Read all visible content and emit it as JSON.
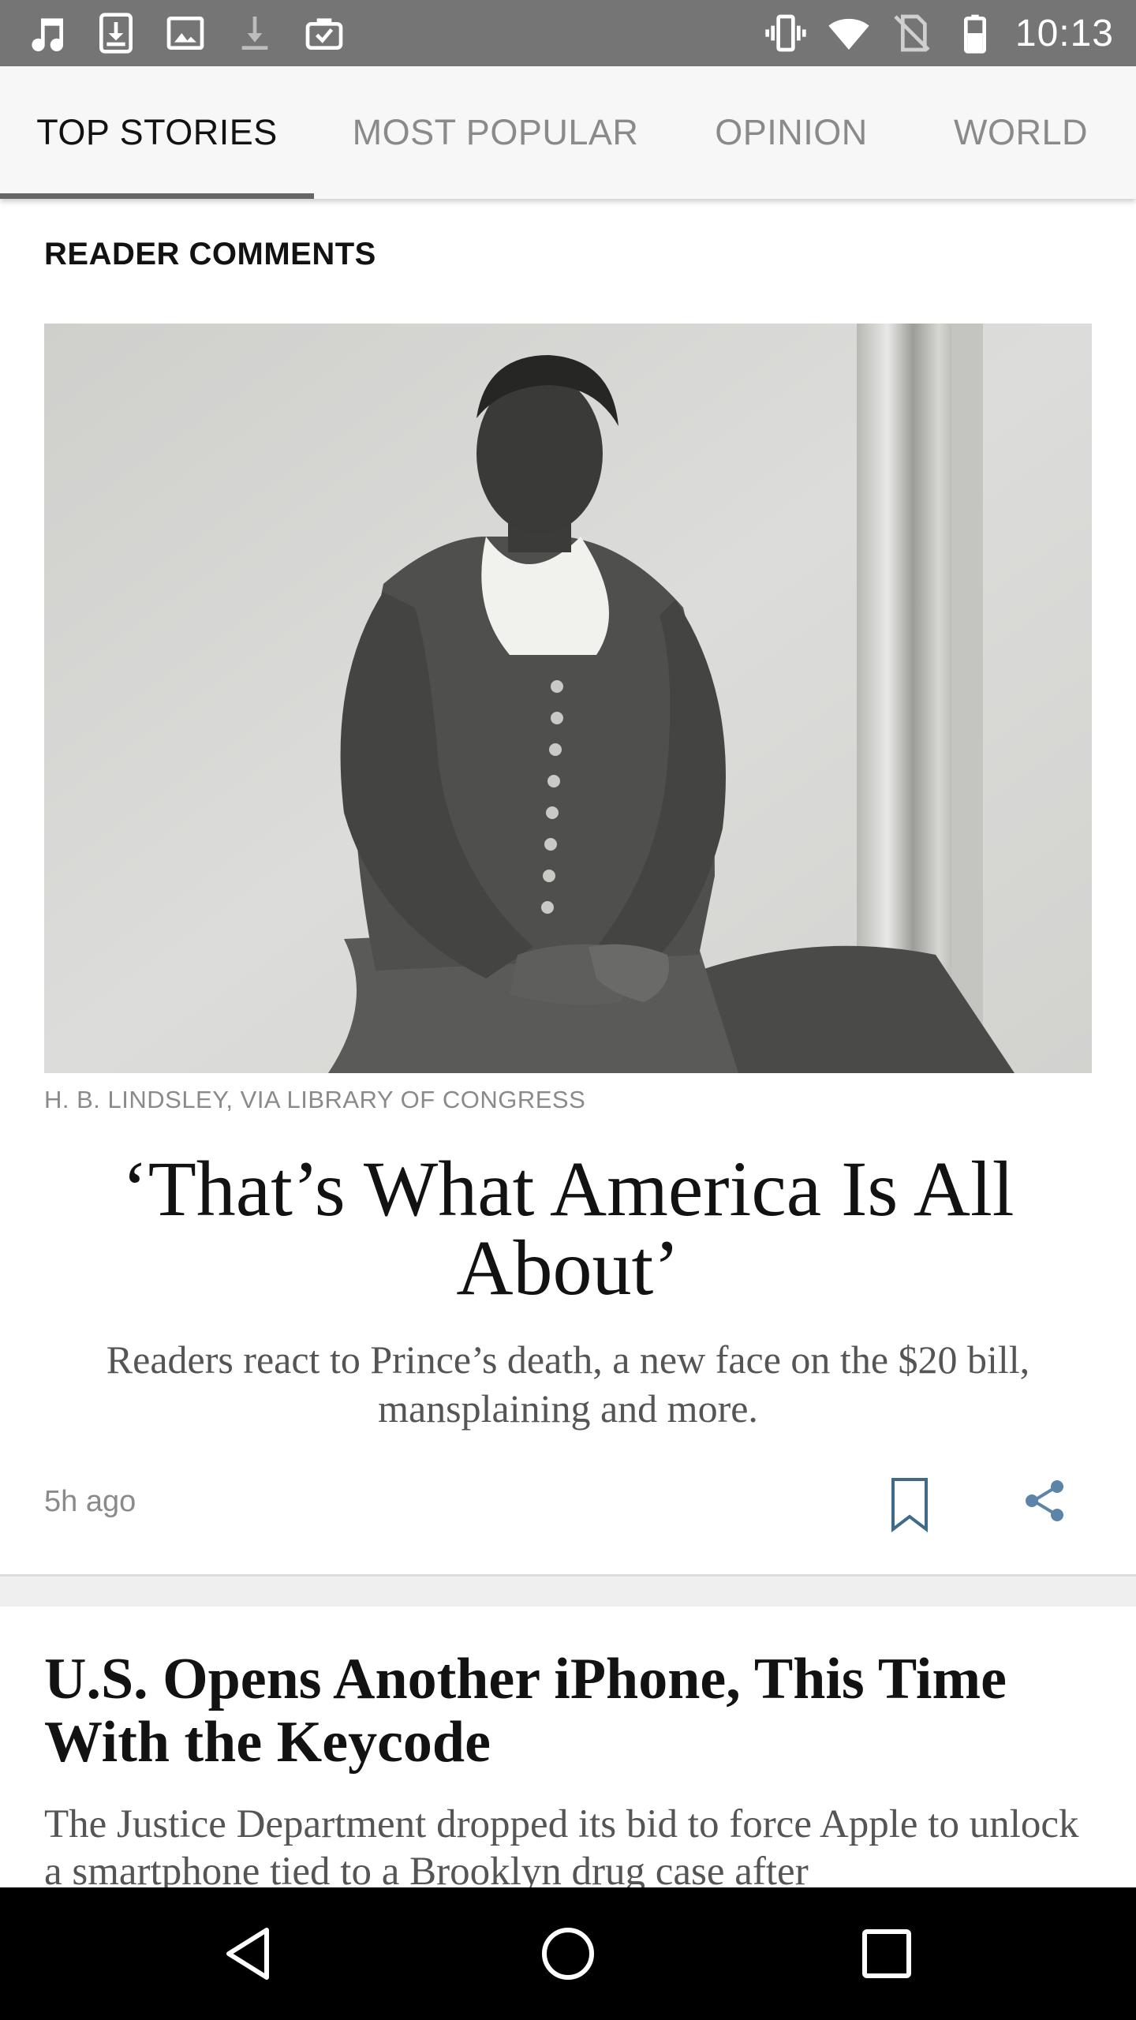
{
  "status_bar": {
    "time": "10:13",
    "left_icons": [
      "music-icon",
      "download-box-icon",
      "image-icon",
      "download-icon",
      "briefcase-check-icon"
    ],
    "right_icons": [
      "vibrate-icon",
      "wifi-icon",
      "no-sim-icon",
      "battery-icon"
    ]
  },
  "tabs": [
    {
      "label": "TOP STORIES",
      "active": true
    },
    {
      "label": "MOST POPULAR",
      "active": false
    },
    {
      "label": "OPINION",
      "active": false
    },
    {
      "label": "WORLD",
      "active": false
    }
  ],
  "article1": {
    "kicker": "READER COMMENTS",
    "photo_credit": "H. B. LINDSLEY, VIA LIBRARY OF CONGRESS",
    "headline": "‘That’s What America Is All About’",
    "summary": "Readers react to Prince’s death, a new face on the $20 bill, mansplaining and more.",
    "timestamp": "5h ago"
  },
  "article2": {
    "headline": "U.S. Opens Another iPhone, This Time With the Keycode",
    "summary": "The Justice Department dropped its bid to force Apple to unlock a smartphone tied to a Brooklyn drug case after"
  },
  "colors": {
    "status_bar": "#757575",
    "tab_bar": "#f7f7f7",
    "bookmark": "#3f6a8a",
    "share": "#5b84a8"
  }
}
